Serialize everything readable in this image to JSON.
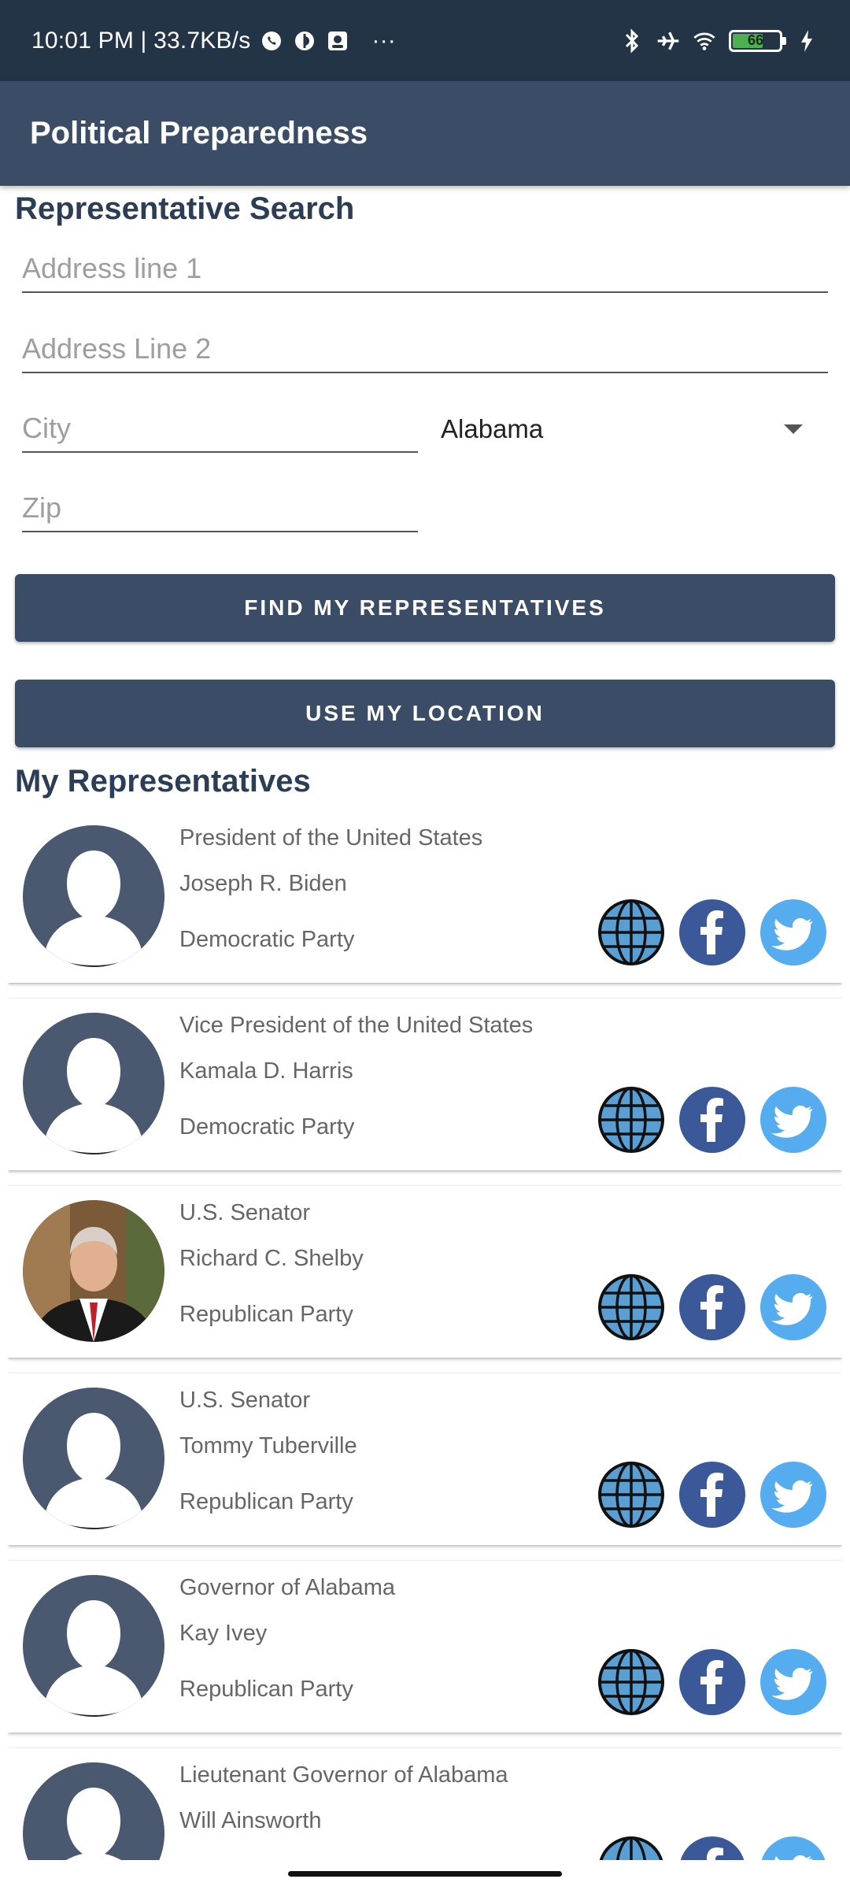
{
  "status_bar": {
    "time_speed": "10:01 PM | 33.7KB/s",
    "overflow": "···",
    "battery_level": "66",
    "colors": {
      "background": "#243447"
    }
  },
  "app_bar": {
    "title": "Political Preparedness",
    "color": "#3b4d66"
  },
  "search": {
    "heading": "Representative Search",
    "address1_placeholder": "Address line 1",
    "address2_placeholder": "Address Line 2",
    "city_placeholder": "City",
    "state_value": "Alabama",
    "zip_placeholder": "Zip"
  },
  "buttons": {
    "find": "FIND MY REPRESENTATIVES",
    "location": "USE MY LOCATION"
  },
  "reps_heading": "My Representatives",
  "representatives": [
    {
      "office": "President of the United States",
      "name": "Joseph R. Biden",
      "party": "Democratic Party",
      "photo": "placeholder"
    },
    {
      "office": "Vice President of the United States",
      "name": "Kamala D. Harris",
      "party": "Democratic Party",
      "photo": "placeholder"
    },
    {
      "office": "U.S. Senator",
      "name": "Richard C. Shelby",
      "party": "Republican Party",
      "photo": "photo"
    },
    {
      "office": "U.S. Senator",
      "name": "Tommy Tuberville",
      "party": "Republican Party",
      "photo": "placeholder"
    },
    {
      "office": "Governor of Alabama",
      "name": "Kay Ivey",
      "party": "Republican Party",
      "photo": "placeholder"
    },
    {
      "office": "Lieutenant Governor of Alabama",
      "name": "Will Ainsworth",
      "party": "",
      "photo": "placeholder"
    }
  ],
  "icons": {
    "website": "globe-icon",
    "facebook": "facebook-icon",
    "twitter": "twitter-icon"
  }
}
